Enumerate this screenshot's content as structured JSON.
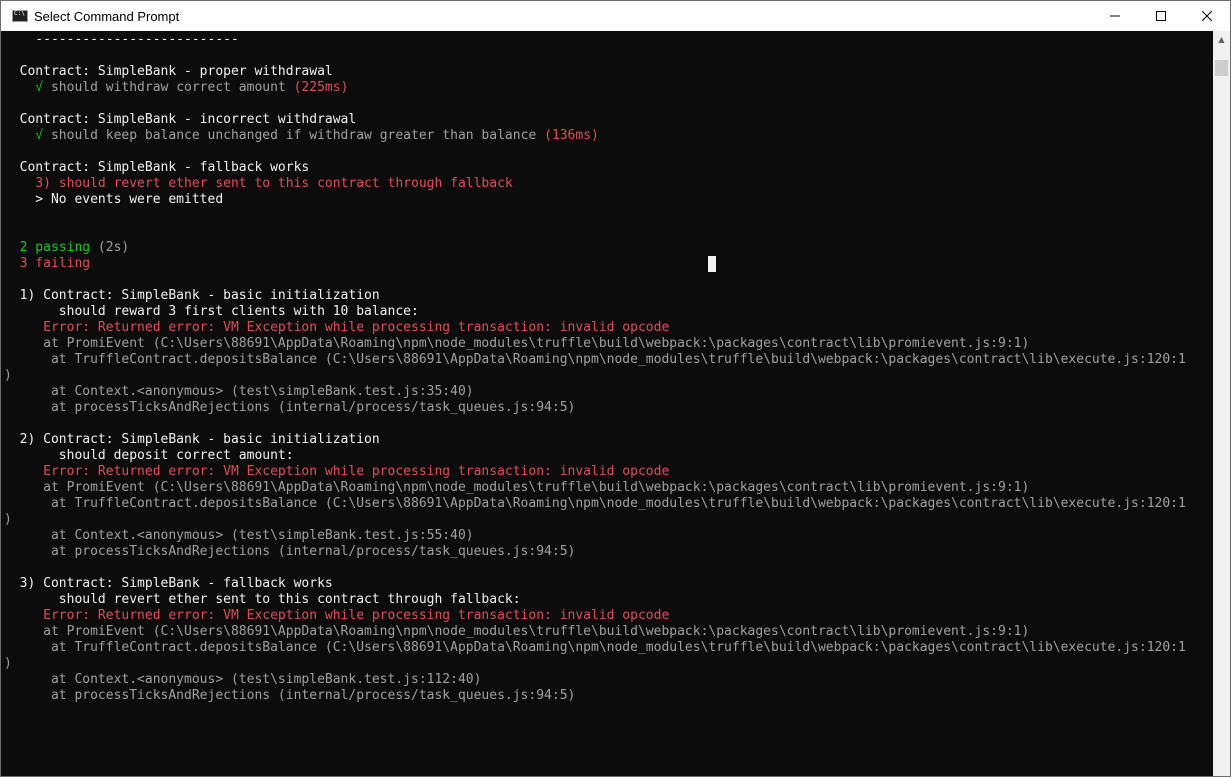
{
  "window": {
    "title": "Select Command Prompt",
    "icon": "cmd-icon",
    "controls": {
      "minimize": "minimize-icon",
      "maximize": "maximize-icon",
      "close": "close-icon"
    }
  },
  "console": {
    "lines": [
      {
        "segments": [
          {
            "text": "    --------------------------",
            "color": "#f2f2f2"
          }
        ]
      },
      {
        "segments": []
      },
      {
        "segments": [
          {
            "text": "  Contract: SimpleBank - proper withdrawal",
            "color": "#f2f2f2"
          }
        ]
      },
      {
        "segments": [
          {
            "text": "    √ ",
            "color": "#16c60c"
          },
          {
            "text": "should withdraw correct amount ",
            "color": "#a0a0a0"
          },
          {
            "text": "(225ms)",
            "color": "#e74856"
          }
        ]
      },
      {
        "segments": []
      },
      {
        "segments": [
          {
            "text": "  Contract: SimpleBank - incorrect withdrawal",
            "color": "#f2f2f2"
          }
        ]
      },
      {
        "segments": [
          {
            "text": "    √ ",
            "color": "#16c60c"
          },
          {
            "text": "should keep balance unchanged if withdraw greater than balance ",
            "color": "#a0a0a0"
          },
          {
            "text": "(136ms)",
            "color": "#e74856"
          }
        ]
      },
      {
        "segments": []
      },
      {
        "segments": [
          {
            "text": "  Contract: SimpleBank - fallback works",
            "color": "#f2f2f2"
          }
        ]
      },
      {
        "segments": [
          {
            "text": "    3) should revert ether sent to this contract through fallback",
            "color": "#e74856"
          }
        ]
      },
      {
        "segments": [
          {
            "text": "    > No events were emitted",
            "color": "#f2f2f2"
          }
        ]
      },
      {
        "segments": []
      },
      {
        "segments": []
      },
      {
        "segments": [
          {
            "text": "  2 passing ",
            "color": "#16c60c"
          },
          {
            "text": "(2s)",
            "color": "#a0a0a0"
          }
        ]
      },
      {
        "segments": [
          {
            "text": "  3 failing",
            "color": "#e74856"
          }
        ]
      },
      {
        "segments": []
      },
      {
        "segments": [
          {
            "text": "  1) Contract: SimpleBank - basic initialization",
            "color": "#f2f2f2"
          }
        ]
      },
      {
        "segments": [
          {
            "text": "       should reward 3 first clients with 10 balance:",
            "color": "#f2f2f2"
          }
        ]
      },
      {
        "segments": [
          {
            "text": "     Error: Returned error: VM Exception while processing transaction: invalid opcode",
            "color": "#e74856"
          }
        ]
      },
      {
        "segments": [
          {
            "text": "     at PromiEvent (C:\\Users\\88691\\AppData\\Roaming\\npm\\node_modules\\truffle\\build\\webpack:\\packages\\contract\\lib\\promievent.js:9:1)",
            "color": "#a0a0a0"
          }
        ]
      },
      {
        "segments": [
          {
            "text": "      at TruffleContract.depositsBalance (C:\\Users\\88691\\AppData\\Roaming\\npm\\node_modules\\truffle\\build\\webpack:\\packages\\contract\\lib\\execute.js:120:1",
            "color": "#a0a0a0"
          }
        ]
      },
      {
        "segments": [
          {
            "text": ")",
            "color": "#a0a0a0"
          }
        ]
      },
      {
        "segments": [
          {
            "text": "      at Context.<anonymous> (test\\simpleBank.test.js:35:40)",
            "color": "#a0a0a0"
          }
        ]
      },
      {
        "segments": [
          {
            "text": "      at processTicksAndRejections (internal/process/task_queues.js:94:5)",
            "color": "#a0a0a0"
          }
        ]
      },
      {
        "segments": []
      },
      {
        "segments": [
          {
            "text": "  2) Contract: SimpleBank - basic initialization",
            "color": "#f2f2f2"
          }
        ]
      },
      {
        "segments": [
          {
            "text": "       should deposit correct amount:",
            "color": "#f2f2f2"
          }
        ]
      },
      {
        "segments": [
          {
            "text": "     Error: Returned error: VM Exception while processing transaction: invalid opcode",
            "color": "#e74856"
          }
        ]
      },
      {
        "segments": [
          {
            "text": "     at PromiEvent (C:\\Users\\88691\\AppData\\Roaming\\npm\\node_modules\\truffle\\build\\webpack:\\packages\\contract\\lib\\promievent.js:9:1)",
            "color": "#a0a0a0"
          }
        ]
      },
      {
        "segments": [
          {
            "text": "      at TruffleContract.depositsBalance (C:\\Users\\88691\\AppData\\Roaming\\npm\\node_modules\\truffle\\build\\webpack:\\packages\\contract\\lib\\execute.js:120:1",
            "color": "#a0a0a0"
          }
        ]
      },
      {
        "segments": [
          {
            "text": ")",
            "color": "#a0a0a0"
          }
        ]
      },
      {
        "segments": [
          {
            "text": "      at Context.<anonymous> (test\\simpleBank.test.js:55:40)",
            "color": "#a0a0a0"
          }
        ]
      },
      {
        "segments": [
          {
            "text": "      at processTicksAndRejections (internal/process/task_queues.js:94:5)",
            "color": "#a0a0a0"
          }
        ]
      },
      {
        "segments": []
      },
      {
        "segments": [
          {
            "text": "  3) Contract: SimpleBank - fallback works",
            "color": "#f2f2f2"
          }
        ]
      },
      {
        "segments": [
          {
            "text": "       should revert ether sent to this contract through fallback:",
            "color": "#f2f2f2"
          }
        ]
      },
      {
        "segments": [
          {
            "text": "     Error: Returned error: VM Exception while processing transaction: invalid opcode",
            "color": "#e74856"
          }
        ]
      },
      {
        "segments": [
          {
            "text": "     at PromiEvent (C:\\Users\\88691\\AppData\\Roaming\\npm\\node_modules\\truffle\\build\\webpack:\\packages\\contract\\lib\\promievent.js:9:1)",
            "color": "#a0a0a0"
          }
        ]
      },
      {
        "segments": [
          {
            "text": "      at TruffleContract.depositsBalance (C:\\Users\\88691\\AppData\\Roaming\\npm\\node_modules\\truffle\\build\\webpack:\\packages\\contract\\lib\\execute.js:120:1",
            "color": "#a0a0a0"
          }
        ]
      },
      {
        "segments": [
          {
            "text": ")",
            "color": "#a0a0a0"
          }
        ]
      },
      {
        "segments": [
          {
            "text": "      at Context.<anonymous> (test\\simpleBank.test.js:112:40)",
            "color": "#a0a0a0"
          }
        ]
      },
      {
        "segments": [
          {
            "text": "      at processTicksAndRejections (internal/process/task_queues.js:94:5)",
            "color": "#a0a0a0"
          }
        ]
      }
    ]
  }
}
